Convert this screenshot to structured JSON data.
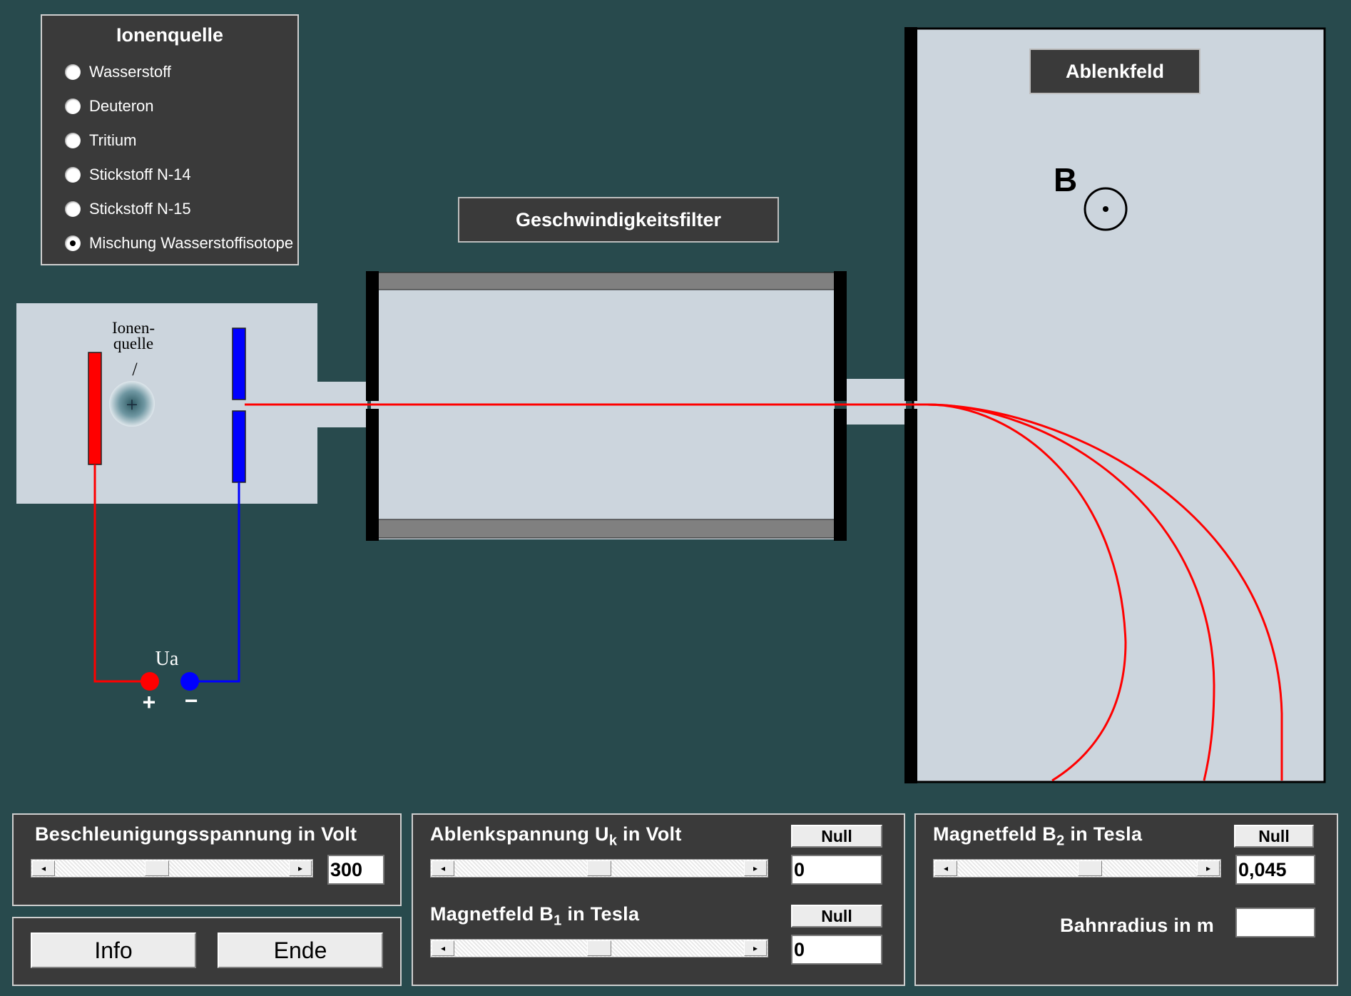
{
  "ion_source_panel": {
    "title": "Ionenquelle",
    "options": [
      {
        "label": "Wasserstoff",
        "checked": false
      },
      {
        "label": "Deuteron",
        "checked": false
      },
      {
        "label": "Tritium",
        "checked": false
      },
      {
        "label": "Stickstoff N-14",
        "checked": false
      },
      {
        "label": "Stickstoff N-15",
        "checked": false
      },
      {
        "label": "Mischung Wasserstoffisotope",
        "checked": true
      }
    ]
  },
  "apparatus": {
    "velocity_filter_label": "Geschwindigkeitsfilter",
    "deflection_field_label": "Ablenkfeld",
    "ion_source_line1": "Ionen-",
    "ion_source_line2": "quelle",
    "ion_source_pointer": "/",
    "ion_symbol": "+",
    "field_symbol": "B",
    "voltage_label": "Ua",
    "plus_label": "+",
    "minus_label": "−"
  },
  "controls": {
    "acceleration": {
      "label": "Beschleunigungsspannung  in Volt",
      "value": "300",
      "slider_fraction": 0.43
    },
    "deflection_voltage": {
      "label_prefix": "Ablenkspannung U",
      "label_sub": "k",
      "label_suffix": " in Volt",
      "null_label": "Null",
      "value": "0",
      "slider_fraction": 0.5
    },
    "magnetic_b1": {
      "label_prefix": "Magnetfeld B",
      "label_sub": "1",
      "label_suffix": " in Tesla",
      "null_label": "Null",
      "value": "0",
      "slider_fraction": 0.5
    },
    "magnetic_b2": {
      "label_prefix": "Magnetfeld B",
      "label_sub": "2",
      "label_suffix": " in Tesla",
      "null_label": "Null",
      "value": "0,045",
      "slider_fraction": 0.56
    },
    "orbit_radius": {
      "label": "Bahnradius in m",
      "value": ""
    },
    "info_button": "Info",
    "end_button": "Ende"
  },
  "colors": {
    "background": "#284a4d",
    "chamber": "#ccd5dd",
    "beam": "#ff0000",
    "positive": "#ff0000",
    "negative": "#0000ff"
  }
}
